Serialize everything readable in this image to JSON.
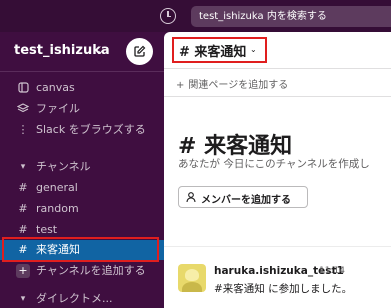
{
  "topbar": {
    "history_icon": "clock-icon",
    "search_placeholder": "test_ishizuka 内を検索する"
  },
  "sidebar": {
    "workspace_name": "test_ishizuka",
    "workspace_caret": "⌄",
    "items": [
      {
        "icon": "canvas-icon",
        "label": "canvas"
      },
      {
        "icon": "files-icon",
        "label": "ファイル"
      },
      {
        "icon": "more-vertical-icon",
        "label": "Slack をブラウズする"
      }
    ],
    "channels_section": {
      "caret": "▾",
      "label": "チャンネル"
    },
    "channels": [
      {
        "prefix": "#",
        "label": "general"
      },
      {
        "prefix": "#",
        "label": "random"
      },
      {
        "prefix": "#",
        "label": "test"
      },
      {
        "prefix": "#",
        "label": "来客通知",
        "active": true
      }
    ],
    "add_channel_label": "チャンネルを追加する",
    "add_channel_icon": "+",
    "dm_section": {
      "caret": "▾",
      "label": "ダイレクトメ..."
    }
  },
  "channel": {
    "title": "# 来客通知",
    "title_caret": "⌄",
    "add_bookmark": "関連ページを追加する",
    "add_bookmark_icon": "+",
    "intro_title": "# 来客通知",
    "intro_desc": "あなたが 今日にこのチャンネルを作成し",
    "add_member_label": "メンバーを追加する"
  },
  "message": {
    "author": "haruka.ishizuka_test1",
    "time": "11:14",
    "text": "#来客通知 に参加しました。"
  },
  "colors": {
    "sidebar_bg": "#3f0e40",
    "topbar_bg": "#350d36",
    "active_channel": "#1164a3",
    "highlight_red": "#e01e1e"
  }
}
